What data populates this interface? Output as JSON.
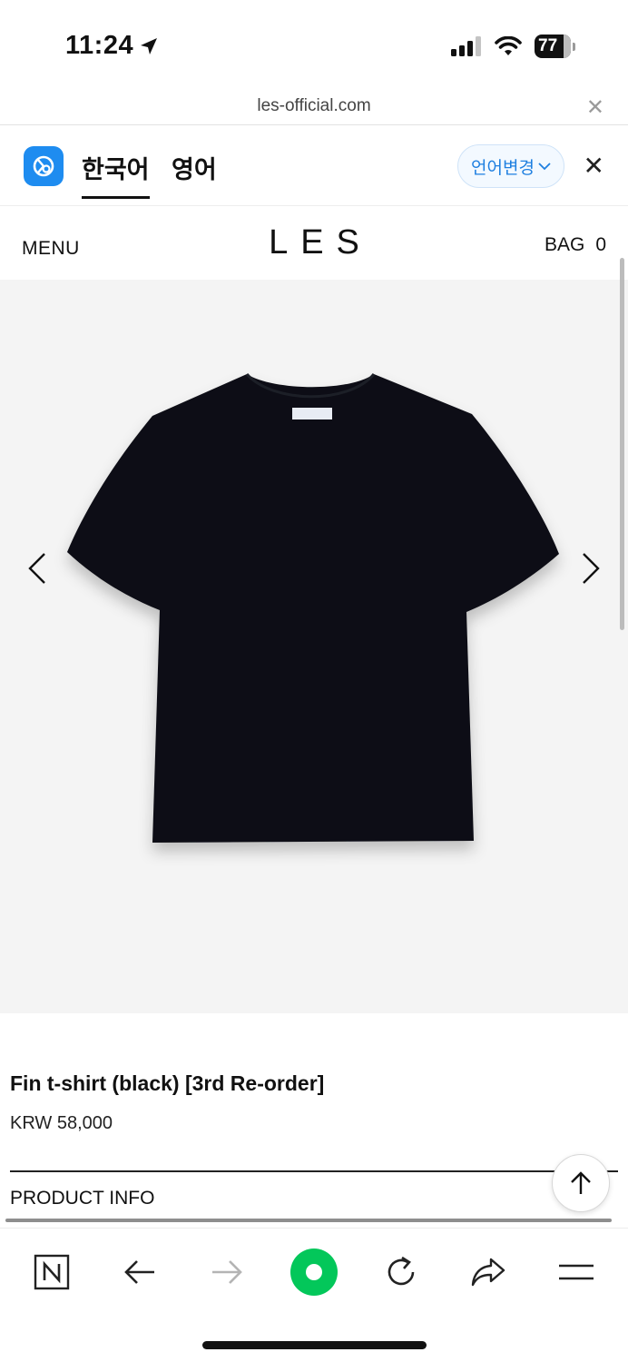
{
  "status_bar": {
    "time": "11:24",
    "battery": "77"
  },
  "url_bar": {
    "domain": "les-official.com"
  },
  "translate_bar": {
    "source_lang": "한국어",
    "target_lang": "영어",
    "change_language_label": "언어변경"
  },
  "site_header": {
    "menu_label": "MENU",
    "logo": "LES",
    "bag_label": "BAG",
    "bag_count": "0"
  },
  "product": {
    "title": "Fin t-shirt (black) [3rd Re-order]",
    "price": "KRW 58,000",
    "info_label": "PRODUCT INFO"
  },
  "colors": {
    "accent_blue": "#1e8cf0",
    "naver_green": "#03c75a",
    "shirt": "#0d0f14",
    "image_bg": "#f4f4f4"
  }
}
